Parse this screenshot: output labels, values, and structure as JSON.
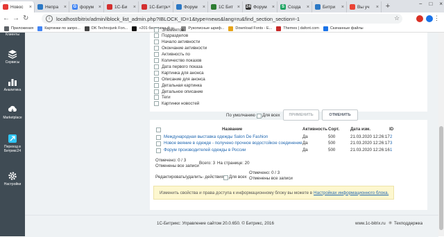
{
  "browser": {
    "tabs": [
      {
        "label": "Новос",
        "active": true,
        "favicon_color": "#e53935"
      },
      {
        "label": "Непрa",
        "favicon_color": "#2b78c5"
      },
      {
        "label": "форум",
        "favicon_color": "#4285f4",
        "icon_char": "G"
      },
      {
        "label": "1С-Би",
        "favicon_color": "#d32f2f"
      },
      {
        "label": "1С-Битри",
        "favicon_color": "#d32f2f"
      },
      {
        "label": "Форум",
        "favicon_color": "#2b78c5"
      },
      {
        "label": "1С Бит",
        "favicon_color": "#2e7d32"
      },
      {
        "label": "Форум",
        "favicon_color": "#333333",
        "icon_char": "24"
      },
      {
        "label": "Созда",
        "favicon_color": "#1da462",
        "icon_char": "S"
      },
      {
        "label": "Битри",
        "favicon_color": "#2b78c5"
      },
      {
        "label": "Вы уч",
        "favicon_color": "#ea4335"
      }
    ],
    "new_tab": "+",
    "window_controls": [
      "−",
      "□",
      "×"
    ],
    "url": "localhost/bitrix/admin/iblock_list_admin.php?IBLOCK_ID=1&type=news&lang=ru&find_section_section=-1"
  },
  "bookmarks": [
    {
      "label": "Приложения",
      "icon_color": "#5f6368"
    },
    {
      "label": "Картинки по запро...",
      "icon_color": "#4285f4"
    },
    {
      "label": "DK Technojunk Fon...",
      "icon_color": "#444444"
    },
    {
      "label": "+201 бесплатный ш...",
      "icon_color": "#111111"
    },
    {
      "label": "Рукописные шриф...",
      "icon_color": "#888888"
    },
    {
      "label": "Download Fonts - E...",
      "icon_color": "#e6a317"
    },
    {
      "label": "Themes | dafont.com",
      "icon_color": "#c62828"
    },
    {
      "label": "Скачанные файлы",
      "icon_color": "#1a73e8"
    }
  ],
  "left_panel": {
    "items": [
      {
        "label": "Клиенты",
        "icon": "users-icon"
      },
      {
        "label": "Сервисы",
        "icon": "layers-icon"
      },
      {
        "label": "Аналитика",
        "icon": "bar-chart-icon"
      },
      {
        "label": "Marketplace",
        "icon": "cloud-download-icon"
      },
      {
        "label": "Переход в Битрикс24",
        "icon": "bitrix24-icon"
      },
      {
        "label": "Настройки",
        "icon": "gear-icon"
      }
    ]
  },
  "fields": [
    "Элементов",
    "Подразделов",
    "Начало активности",
    "Окончание активности",
    "Активность по",
    "Количество показов",
    "Дата первого показа",
    "Картинка для анонса",
    "Описание для анонса",
    "Детальная картинка",
    "Детальное описание",
    "Теги",
    "Картинки новостей"
  ],
  "settings_bar": {
    "default_label": "По умолчанию",
    "for_all_label": "Для всех",
    "apply_button": "ПРИМЕНИТЬ",
    "cancel_button": "ОТМЕНИТЬ"
  },
  "table": {
    "headers": {
      "name": "Название",
      "active": "Активность",
      "sort": "Сорт.",
      "date": "Дата изм.",
      "id": "ID"
    },
    "rows": [
      {
        "name": "Международная выставка одежды Salon De Fashion",
        "active": "Да",
        "sort": "500",
        "date": "21.03.2020 12:26:17",
        "id": "2"
      },
      {
        "name": "Новое веяние в одежде - полученo прочное водостойкое соединение",
        "active": "Да",
        "sort": "500",
        "date": "21.03.2020 12:26:17",
        "id": "3"
      },
      {
        "name": "Форум производителей одежды в России",
        "active": "Да",
        "sort": "500",
        "date": "21.03.2020 12:26:16",
        "id": "1"
      }
    ],
    "marked_label": "Отмечено: 0 / 3",
    "marked_all_label": "Отменены все записи",
    "total_label": "Всего: 3",
    "per_page_label": "На странице: 20",
    "bottom_actions_label": "Редактировать/удалить- действия -",
    "bottom_for_all": "Для всех",
    "bottom_marked": "Отмечено: 0 / 3",
    "bottom_marked_all": "Отменены все записи"
  },
  "notice": {
    "text": "Изменить свойства и права доступа к информационному блоку вы можете в",
    "link": "Настройках информационного блока."
  },
  "footer": {
    "copyright": "1С-Битрикс: Управление сайтом 20.0.650. © Битрикс, 2016",
    "site": "www.1c-bitrix.ru",
    "support": "Техподдержка"
  }
}
